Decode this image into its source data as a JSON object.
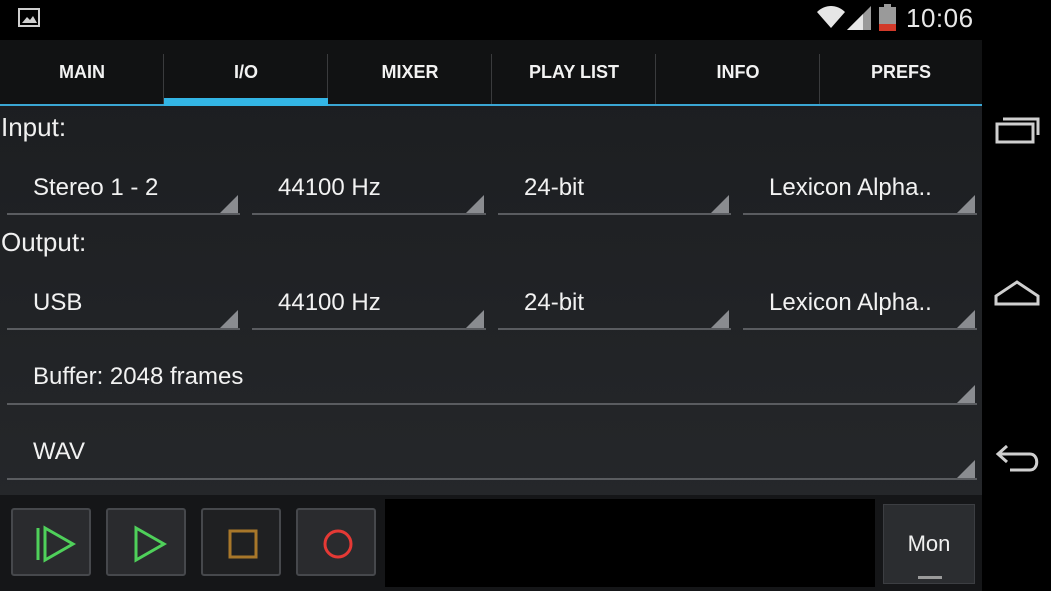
{
  "status_bar": {
    "time": "10:06",
    "icons": [
      "gallery-icon",
      "wifi-icon",
      "signal-icon",
      "battery-icon"
    ],
    "battery_color": "#d23a2a"
  },
  "tabs": [
    {
      "label": "MAIN",
      "active": false
    },
    {
      "label": "I/O",
      "active": true
    },
    {
      "label": "MIXER",
      "active": false
    },
    {
      "label": "PLAY LIST",
      "active": false
    },
    {
      "label": "INFO",
      "active": false
    },
    {
      "label": "PREFS",
      "active": false
    }
  ],
  "accent_color": "#33b5e5",
  "input": {
    "label": "Input:",
    "channel": "Stereo 1 - 2",
    "sample_rate": "44100 Hz",
    "bit_depth": "24-bit",
    "device": "Lexicon Alpha.."
  },
  "output": {
    "label": "Output:",
    "channel": "USB",
    "sample_rate": "44100 Hz",
    "bit_depth": "24-bit",
    "device": "Lexicon Alpha.."
  },
  "buffer": "Buffer: 2048 frames",
  "format": "WAV",
  "transport": {
    "buttons": [
      "play-from-start-icon",
      "play-icon",
      "stop-icon",
      "record-icon"
    ],
    "colors": {
      "play": "#4fd05a",
      "stop": "#a8772a",
      "record": "#e53935"
    },
    "monitor_label": "Mon"
  },
  "nav_bar": {
    "icons": [
      "recent-apps-icon",
      "home-icon",
      "back-icon"
    ]
  }
}
